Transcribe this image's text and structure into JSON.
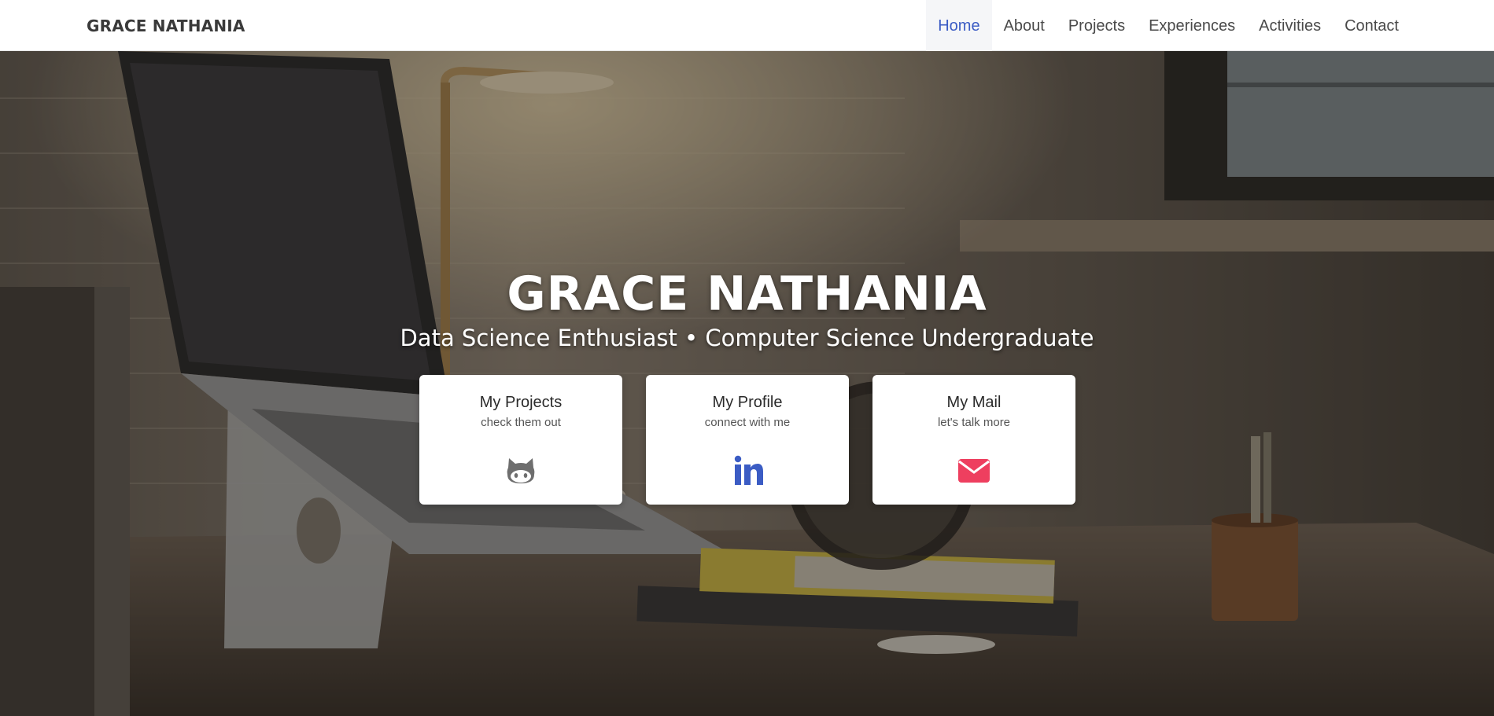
{
  "navbar": {
    "brand": "GRACE NATHANIA",
    "items": [
      {
        "label": "Home",
        "active": true
      },
      {
        "label": "About"
      },
      {
        "label": "Projects"
      },
      {
        "label": "Experiences"
      },
      {
        "label": "Activities"
      },
      {
        "label": "Contact"
      }
    ]
  },
  "hero": {
    "title": "GRACE NATHANIA",
    "subtitle": "Data Science Enthusiast • Computer Science Undergraduate",
    "cards": [
      {
        "title": "My Projects",
        "description": "check them out",
        "icon": "github-icon",
        "icon_color": "#6e6e6e"
      },
      {
        "title": "My Profile",
        "description": "connect with me",
        "icon": "linkedin-icon",
        "icon_color": "#3b5cc4"
      },
      {
        "title": "My Mail",
        "description": "let's talk more",
        "icon": "mail-icon",
        "icon_color": "#ee3f5f"
      }
    ]
  },
  "colors": {
    "accent": "#3b5cc4",
    "nav_text": "#4a4a4a",
    "card_bg": "#ffffff"
  }
}
